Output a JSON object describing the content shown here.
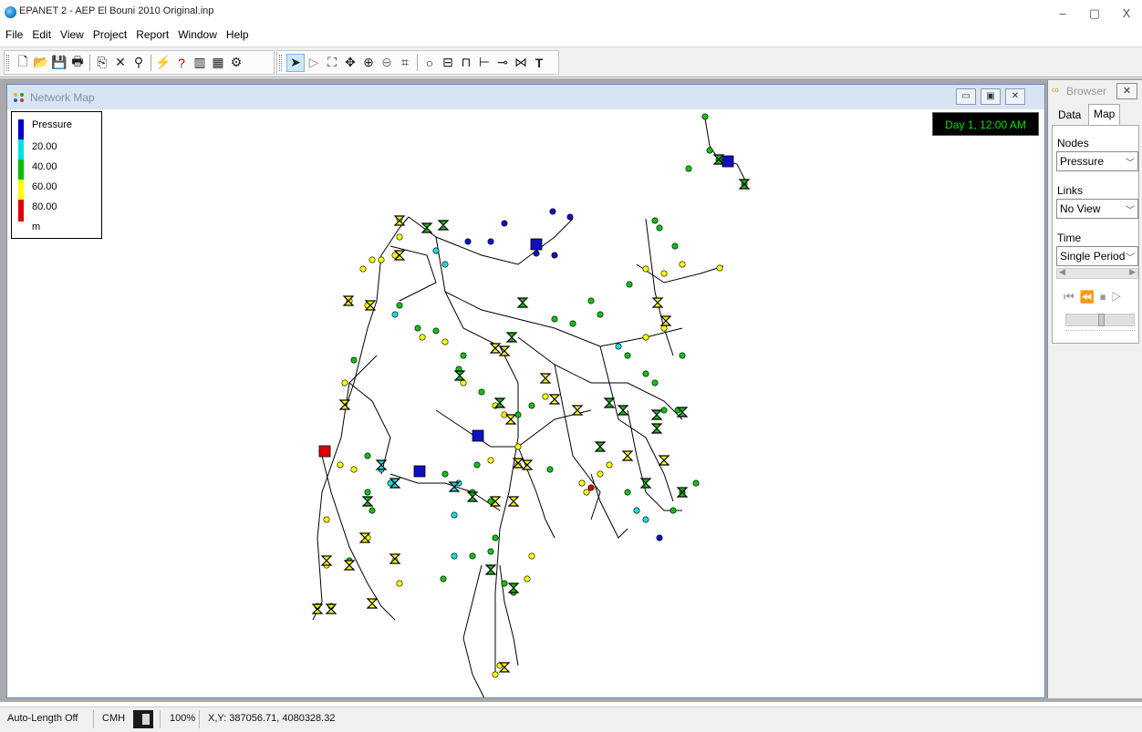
{
  "app": {
    "title": "EPANET 2 - AEP El Bouni 2010 Original.inp"
  },
  "window_controls": {
    "minimize": "–",
    "restore": "▢",
    "close": "X"
  },
  "menu": [
    "File",
    "Edit",
    "View",
    "Project",
    "Report",
    "Window",
    "Help"
  ],
  "network_map": {
    "title": "Network Map",
    "time_label": "Day 1, 12:00 AM",
    "legend": {
      "title": "Pressure",
      "values": [
        "20.00",
        "40.00",
        "60.00",
        "80.00"
      ],
      "unit": "m",
      "colors": [
        "#0000c8",
        "#00e0e0",
        "#00c000",
        "#ffff00",
        "#e00000"
      ]
    },
    "node_colors": {
      "blue": "#1010c0",
      "cyan": "#20d8e0",
      "green": "#10c010",
      "yellow": "#ffff00",
      "red": "#e00000"
    }
  },
  "browser": {
    "title": "Browser",
    "tabs": [
      "Data",
      "Map"
    ],
    "active_tab": "Map",
    "nodes_label": "Nodes",
    "nodes_value": "Pressure",
    "links_label": "Links",
    "links_value": "No View",
    "time_label": "Time",
    "time_value": "Single Period"
  },
  "status": {
    "auto_length": "Auto-Length Off",
    "flow_units": "CMH",
    "zoom": "100%",
    "coords": "X,Y: 387056.71, 4080328.32"
  }
}
